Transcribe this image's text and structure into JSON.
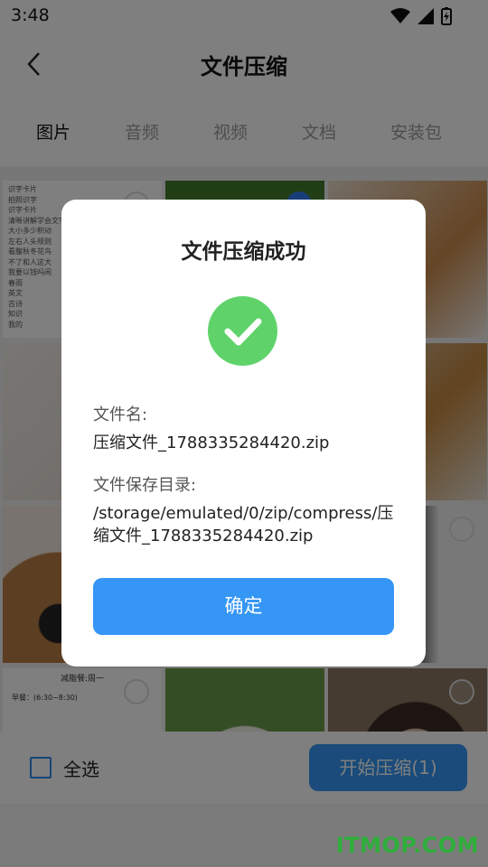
{
  "status": {
    "time": "3:48"
  },
  "header": {
    "title": "文件压缩"
  },
  "tabs": [
    {
      "label": "图片",
      "active": true
    },
    {
      "label": "音频"
    },
    {
      "label": "视频"
    },
    {
      "label": "文档"
    },
    {
      "label": "安装包"
    }
  ],
  "grid": {
    "text_image_lines": [
      "识字卡片",
      "拍照识字",
      "识字卡片",
      "清晰讲解学会文字",
      "大小多少积动",
      "左右人头规则",
      "看腹秋冬花鸟",
      "不了和人这大",
      "我要以钱吗闲",
      "春雨",
      "英文",
      "古诗",
      "知识",
      "我的"
    ],
    "meal_image": {
      "title": "减脂餐:周一",
      "row": "早餐：(6:30~8:30)"
    }
  },
  "bottom": {
    "select_all": "全选",
    "start_button": "开始压缩(1)"
  },
  "dialog": {
    "title": "文件压缩成功",
    "filename_label": "文件名:",
    "filename": "压缩文件_1788335284420.zip",
    "dir_label": "文件保存目录:",
    "dir": "/storage/emulated/0/zip/compress/压缩文件_1788335284420.zip",
    "ok_button": "确定"
  },
  "watermark": "ITMOP.COM",
  "colors": {
    "accent": "#3596f5",
    "success": "#5fd36a"
  }
}
